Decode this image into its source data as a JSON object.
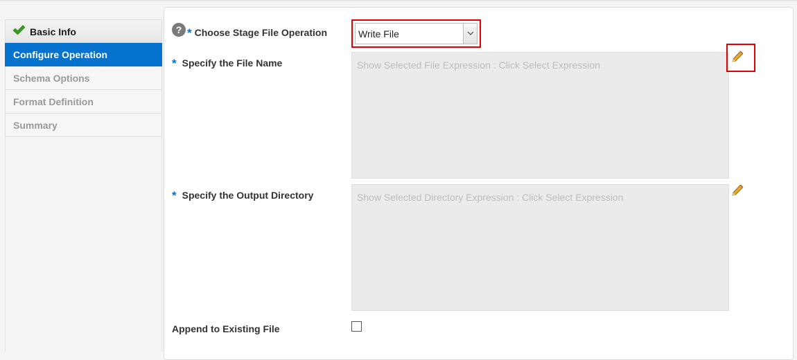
{
  "sidebar": {
    "steps": [
      {
        "label": "Basic Info",
        "state": "completed"
      },
      {
        "label": "Configure Operation",
        "state": "active"
      },
      {
        "label": "Schema Options",
        "state": "disabled"
      },
      {
        "label": "Format Definition",
        "state": "disabled"
      },
      {
        "label": "Summary",
        "state": "disabled"
      }
    ]
  },
  "form": {
    "operation": {
      "label": "Choose Stage File Operation",
      "required_mark": "*",
      "value": "Write File"
    },
    "file_name": {
      "label": "Specify the File Name",
      "required_mark": "*",
      "placeholder": "Show Selected File Expression : Click Select Expression"
    },
    "output_directory": {
      "label": "Specify the Output Directory",
      "required_mark": "*",
      "placeholder": "Show Selected Directory Expression : Click Select Expression"
    },
    "append": {
      "label": "Append to Existing File",
      "checked": false
    }
  },
  "icons": {
    "step_done": "check-icon",
    "help": "help-icon",
    "dropdown": "chevron-down-icon",
    "edit": "pencil-icon"
  },
  "colors": {
    "active_step": "#0572ce",
    "required": "#0572ce",
    "highlight": "#e00000",
    "check": "#3a9d23"
  }
}
